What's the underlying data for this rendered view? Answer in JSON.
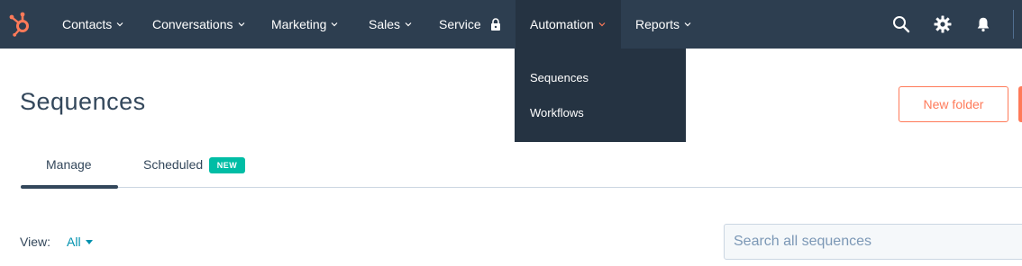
{
  "nav": {
    "items": [
      {
        "label": "Contacts"
      },
      {
        "label": "Conversations"
      },
      {
        "label": "Marketing"
      },
      {
        "label": "Sales"
      },
      {
        "label": "Service",
        "icon": "lock-icon"
      },
      {
        "label": "Automation",
        "active": true
      },
      {
        "label": "Reports"
      }
    ],
    "icons": [
      "search-icon",
      "gear-icon",
      "bell-icon"
    ]
  },
  "dropdown": {
    "items": [
      {
        "label": "Sequences"
      },
      {
        "label": "Workflows"
      }
    ]
  },
  "page": {
    "title": "Sequences",
    "new_folder_label": "New folder"
  },
  "tabs": [
    {
      "label": "Manage",
      "active": true
    },
    {
      "label": "Scheduled",
      "badge": "NEW"
    }
  ],
  "filters": {
    "view_label": "View:",
    "view_value": "All"
  },
  "search": {
    "placeholder": "Search all sequences"
  },
  "colors": {
    "nav_bg": "#2d3e50",
    "accent": "#ff7a59",
    "link": "#0091ae",
    "badge": "#00bda5"
  }
}
